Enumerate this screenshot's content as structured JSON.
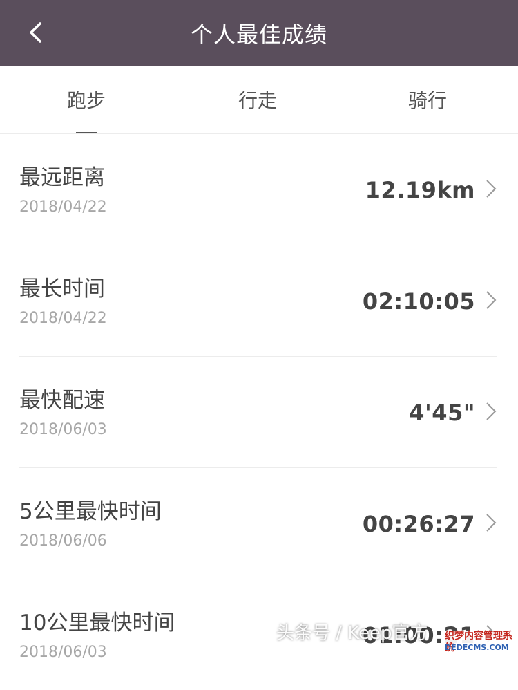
{
  "header": {
    "title": "个人最佳成绩",
    "back_icon": "chevron-left-icon"
  },
  "tabs": [
    {
      "label": "跑步",
      "active": true
    },
    {
      "label": "行走",
      "active": false
    },
    {
      "label": "骑行",
      "active": false
    }
  ],
  "records": [
    {
      "title": "最远距离",
      "date": "2018/04/22",
      "value": "12.19km"
    },
    {
      "title": "最长时间",
      "date": "2018/04/22",
      "value": "02:10:05"
    },
    {
      "title": "最快配速",
      "date": "2018/06/03",
      "value": "4'45\""
    },
    {
      "title": "5公里最快时间",
      "date": "2018/06/06",
      "value": "00:26:27"
    },
    {
      "title": "10公里最快时间",
      "date": "2018/06/03",
      "value": "01:00:21"
    }
  ],
  "overlay": {
    "watermark": "头条号 / Keep官方",
    "logo_main": "织梦内容管理系统",
    "logo_sub": "DEDECMS.COM"
  },
  "colors": {
    "header_bg": "#5a4e5c",
    "text_primary": "#444444",
    "text_secondary": "#a7a7a7"
  }
}
